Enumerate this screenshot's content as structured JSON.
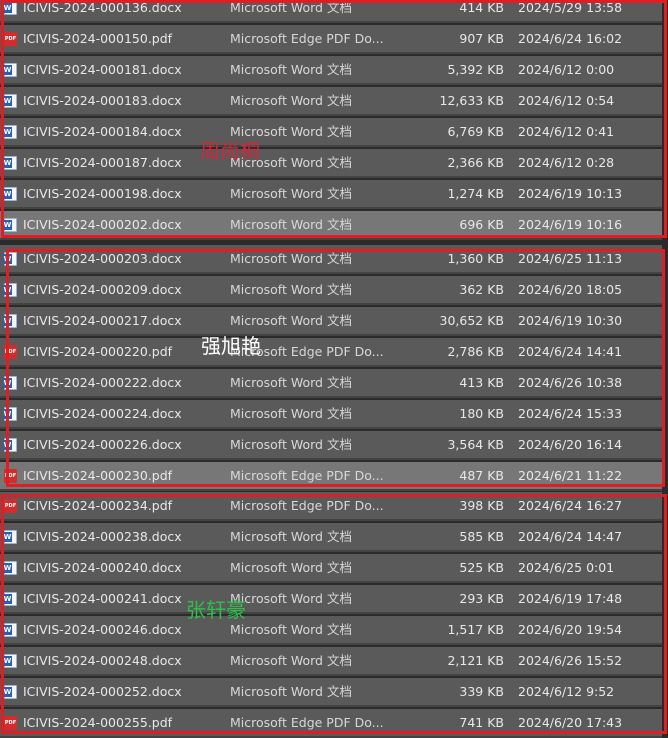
{
  "colors": {
    "row_background": "#5a5a5a",
    "selected_row_background": "#777777",
    "frame_border": "#e11d24",
    "word_icon": "#2b5fb0",
    "pdf_icon": "#d62b2b"
  },
  "groups": [
    {
      "handwritten_name": "周尚桐",
      "handwritten_color": "#d0283a",
      "rows": [
        {
          "icon": "word-icon",
          "name": "ICIVIS-2024-000136.docx",
          "type": "Microsoft Word 文档",
          "size": "414 KB",
          "date": "2024/5/29 13:58"
        },
        {
          "icon": "pdf-icon",
          "name": "ICIVIS-2024-000150.pdf",
          "type": "Microsoft Edge PDF Do...",
          "size": "907 KB",
          "date": "2024/6/24 16:02"
        },
        {
          "icon": "word-icon",
          "name": "ICIVIS-2024-000181.docx",
          "type": "Microsoft Word 文档",
          "size": "5,392 KB",
          "date": "2024/6/12 0:00"
        },
        {
          "icon": "word-icon",
          "name": "ICIVIS-2024-000183.docx",
          "type": "Microsoft Word 文档",
          "size": "12,633 KB",
          "date": "2024/6/12 0:54"
        },
        {
          "icon": "word-icon",
          "name": "ICIVIS-2024-000184.docx",
          "type": "Microsoft Word 文档",
          "size": "6,769 KB",
          "date": "2024/6/12 0:41"
        },
        {
          "icon": "word-icon",
          "name": "ICIVIS-2024-000187.docx",
          "type": "Microsoft Word 文档",
          "size": "2,366 KB",
          "date": "2024/6/12 0:28"
        },
        {
          "icon": "word-icon",
          "name": "ICIVIS-2024-000198.docx",
          "type": "Microsoft Word 文档",
          "size": "1,274 KB",
          "date": "2024/6/19 10:13"
        },
        {
          "icon": "word-icon",
          "name": "ICIVIS-2024-000202.docx",
          "type": "Microsoft Word 文档",
          "size": "696 KB",
          "date": "2024/6/19 10:16",
          "selected": true
        }
      ]
    },
    {
      "handwritten_name": "强旭艳",
      "handwritten_color": "#ffffff",
      "rows": [
        {
          "icon": "word-icon",
          "name": "ICIVIS-2024-000203.docx",
          "type": "Microsoft Word 文档",
          "size": "1,360 KB",
          "date": "2024/6/25 11:13"
        },
        {
          "icon": "word-icon",
          "name": "ICIVIS-2024-000209.docx",
          "type": "Microsoft Word 文档",
          "size": "362 KB",
          "date": "2024/6/20 18:05"
        },
        {
          "icon": "word-icon",
          "name": "ICIVIS-2024-000217.docx",
          "type": "Microsoft Word 文档",
          "size": "30,652 KB",
          "date": "2024/6/19 10:30"
        },
        {
          "icon": "pdf-icon",
          "name": "ICIVIS-2024-000220.pdf",
          "type": "Microsoft Edge PDF Do...",
          "size": "2,786 KB",
          "date": "2024/6/24 14:41"
        },
        {
          "icon": "word-icon",
          "name": "ICIVIS-2024-000222.docx",
          "type": "Microsoft Word 文档",
          "size": "413 KB",
          "date": "2024/6/26 10:38"
        },
        {
          "icon": "word-icon",
          "name": "ICIVIS-2024-000224.docx",
          "type": "Microsoft Word 文档",
          "size": "180 KB",
          "date": "2024/6/24 15:33"
        },
        {
          "icon": "word-icon",
          "name": "ICIVIS-2024-000226.docx",
          "type": "Microsoft Word 文档",
          "size": "3,564 KB",
          "date": "2024/6/20 16:14"
        },
        {
          "icon": "pdf-icon",
          "name": "ICIVIS-2024-000230.pdf",
          "type": "Microsoft Edge PDF Do...",
          "size": "487 KB",
          "date": "2024/6/21 11:22",
          "selected": true
        }
      ]
    },
    {
      "handwritten_name": "张轩豪",
      "handwritten_color": "#2fbf4a",
      "rows": [
        {
          "icon": "pdf-icon",
          "name": "ICIVIS-2024-000234.pdf",
          "type": "Microsoft Edge PDF Do...",
          "size": "398 KB",
          "date": "2024/6/24 16:27"
        },
        {
          "icon": "word-icon",
          "name": "ICIVIS-2024-000238.docx",
          "type": "Microsoft Word 文档",
          "size": "585 KB",
          "date": "2024/6/24 14:47"
        },
        {
          "icon": "word-icon",
          "name": "ICIVIS-2024-000240.docx",
          "type": "Microsoft Word 文档",
          "size": "525 KB",
          "date": "2024/6/25 0:01"
        },
        {
          "icon": "word-icon",
          "name": "ICIVIS-2024-000241.docx",
          "type": "Microsoft Word 文档",
          "size": "293 KB",
          "date": "2024/6/19 17:48"
        },
        {
          "icon": "word-icon",
          "name": "ICIVIS-2024-000246.docx",
          "type": "Microsoft Word 文档",
          "size": "1,517 KB",
          "date": "2024/6/20 19:54"
        },
        {
          "icon": "word-icon",
          "name": "ICIVIS-2024-000248.docx",
          "type": "Microsoft Word 文档",
          "size": "2,121 KB",
          "date": "2024/6/26 15:52"
        },
        {
          "icon": "word-icon",
          "name": "ICIVIS-2024-000252.docx",
          "type": "Microsoft Word 文档",
          "size": "339 KB",
          "date": "2024/6/12 9:52"
        },
        {
          "icon": "pdf-icon",
          "name": "ICIVIS-2024-000255.pdf",
          "type": "Microsoft Edge PDF Do...",
          "size": "741 KB",
          "date": "2024/6/20 17:43"
        }
      ]
    }
  ]
}
